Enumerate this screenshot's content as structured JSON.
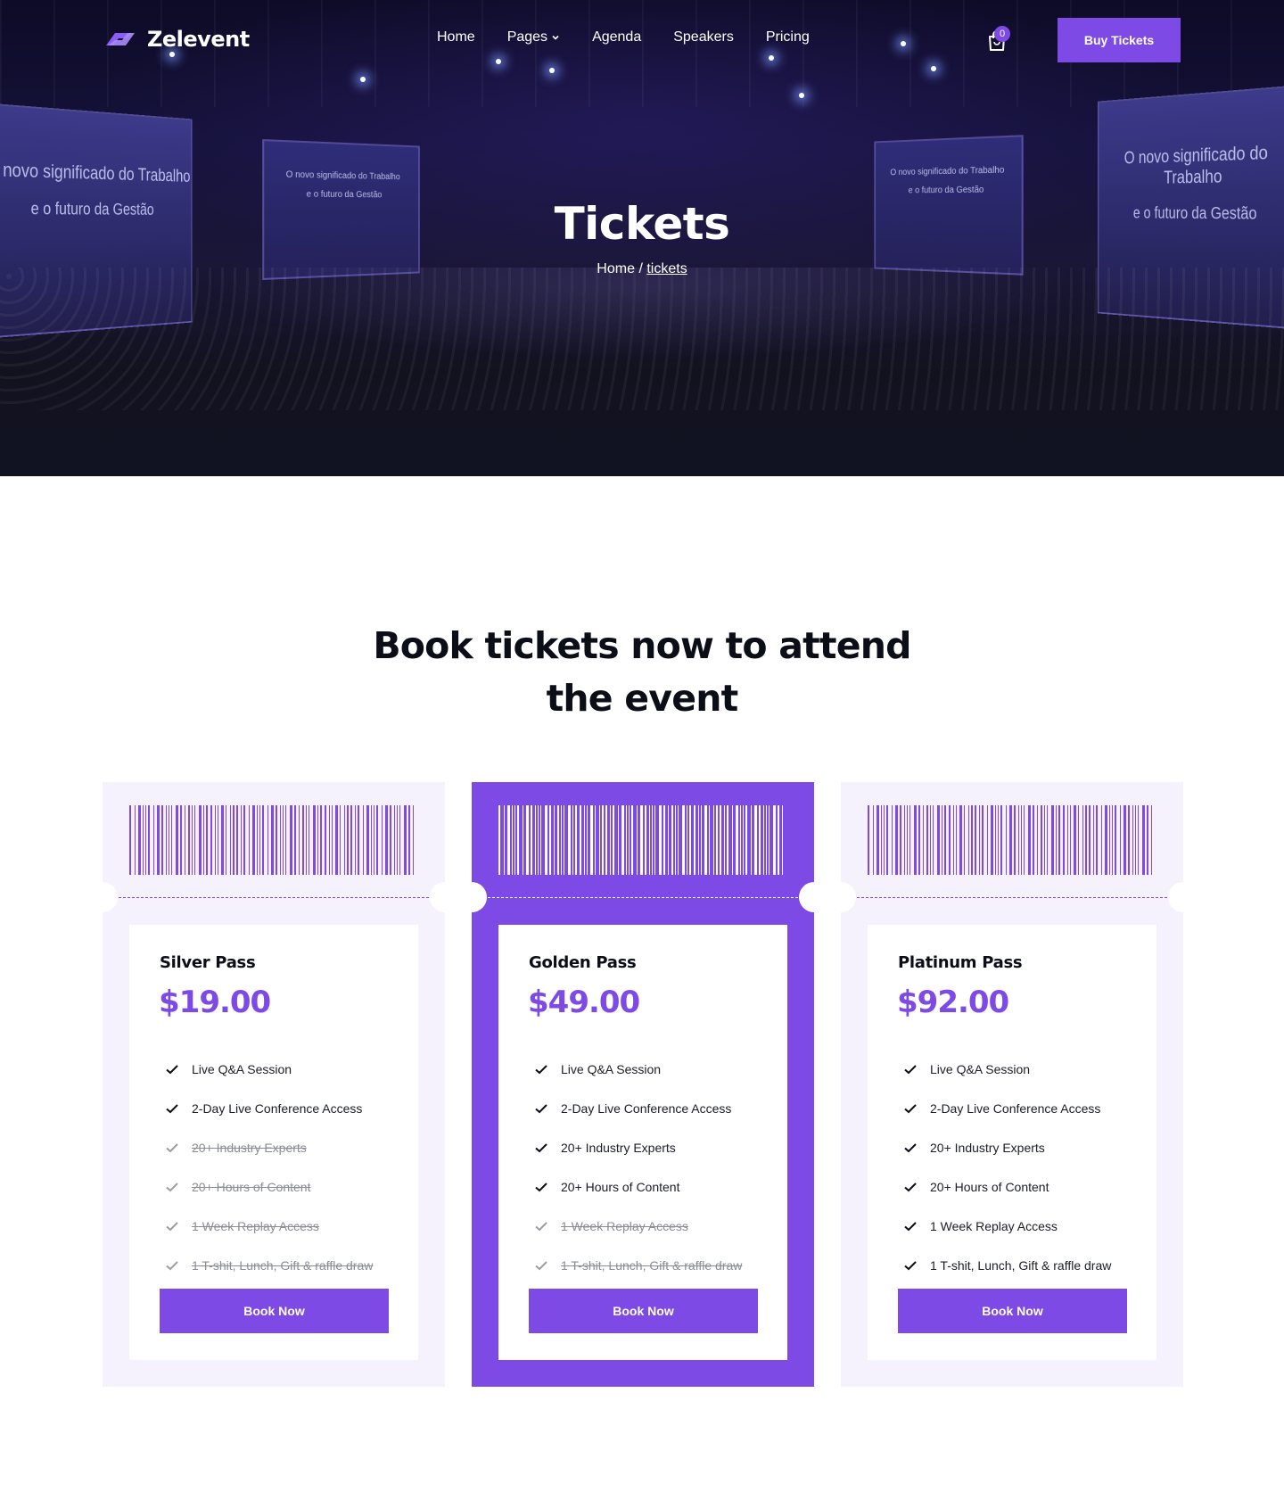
{
  "brand": {
    "name": "Zelevent",
    "accent": "#7d4ae6"
  },
  "nav": {
    "items": [
      {
        "label": "Home"
      },
      {
        "label": "Pages",
        "icon": "chevron-down-icon"
      },
      {
        "label": "Agenda"
      },
      {
        "label": "Speakers"
      },
      {
        "label": "Pricing"
      }
    ],
    "cart_count": "0",
    "cta_label": "Buy Tickets"
  },
  "hero": {
    "title": "Tickets",
    "breadcrumb_home": "Home",
    "breadcrumb_sep": "/",
    "breadcrumb_current": "tickets",
    "screen_line1": "O novo significado do Trabalho",
    "screen_line2": "e o futuro da Gestão"
  },
  "section": {
    "title_line1": "Book tickets now to attend",
    "title_line2": "the event"
  },
  "tickets": [
    {
      "name": "Silver Pass",
      "price": "$19.00",
      "featured": false,
      "button": "Book Now",
      "features": [
        {
          "label": "Live Q&A Session",
          "included": true
        },
        {
          "label": "2-Day Live Conference Access",
          "included": true
        },
        {
          "label": "20+ Industry Experts",
          "included": false
        },
        {
          "label": "20+ Hours of Content",
          "included": false
        },
        {
          "label": "1 Week Replay Access",
          "included": false
        },
        {
          "label": "1 T-shit, Lunch, Gift & raffle draw",
          "included": false
        }
      ]
    },
    {
      "name": "Golden Pass",
      "price": "$49.00",
      "featured": true,
      "button": "Book Now",
      "features": [
        {
          "label": "Live Q&A Session",
          "included": true
        },
        {
          "label": "2-Day Live Conference Access",
          "included": true
        },
        {
          "label": "20+ Industry Experts",
          "included": true
        },
        {
          "label": "20+ Hours of Content",
          "included": true
        },
        {
          "label": "1 Week Replay Access",
          "included": false
        },
        {
          "label": "1 T-shit, Lunch, Gift & raffle draw",
          "included": false
        }
      ]
    },
    {
      "name": "Platinum Pass",
      "price": "$92.00",
      "featured": false,
      "button": "Book Now",
      "features": [
        {
          "label": "Live Q&A Session",
          "included": true
        },
        {
          "label": "2-Day Live Conference Access",
          "included": true
        },
        {
          "label": "20+ Industry Experts",
          "included": true
        },
        {
          "label": "20+ Hours of Content",
          "included": true
        },
        {
          "label": "1 Week Replay Access",
          "included": true
        },
        {
          "label": "1 T-shit, Lunch, Gift & raffle draw",
          "included": true
        }
      ]
    }
  ]
}
